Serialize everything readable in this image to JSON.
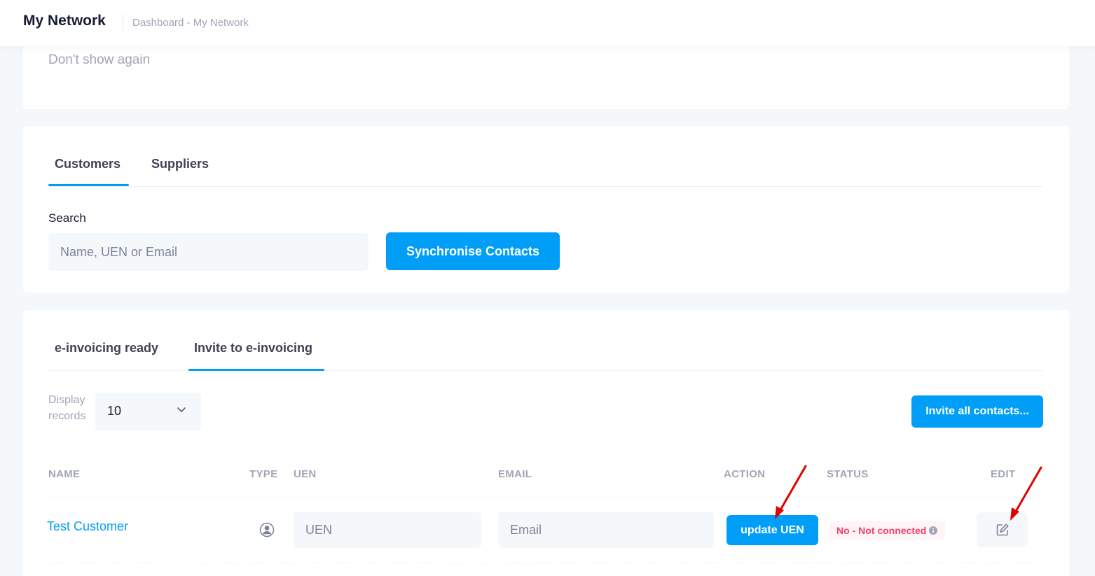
{
  "header": {
    "title": "My Network",
    "breadcrumb": "Dashboard - My Network"
  },
  "notice": {
    "dont_show_again": "Don't show again"
  },
  "contact_tabs": {
    "items": [
      {
        "label": "Customers",
        "active": true
      },
      {
        "label": "Suppliers",
        "active": false
      }
    ]
  },
  "search": {
    "label": "Search",
    "placeholder": "Name, UEN or Email",
    "sync_button": "Synchronise Contacts"
  },
  "invoice_tabs": {
    "items": [
      {
        "label": "e-invoicing ready",
        "active": false
      },
      {
        "label": "Invite to e-invoicing",
        "active": true
      }
    ]
  },
  "table_controls": {
    "display_label": "Display records",
    "display_value": "10",
    "invite_all_button": "Invite all contacts..."
  },
  "table": {
    "columns": [
      "NAME",
      "TYPE",
      "UEN",
      "EMAIL",
      "ACTION",
      "STATUS",
      "EDIT"
    ],
    "rows": [
      {
        "name": "Test Customer",
        "type_icon": "user-circle-icon",
        "uen_placeholder": "UEN",
        "email_placeholder": "Email",
        "action_label": "update UEN",
        "status": "No - Not connected",
        "edit_icon": "edit-icon"
      }
    ]
  },
  "colors": {
    "primary": "#009ef7",
    "danger": "#f1416c",
    "danger_light": "#fff5f8",
    "annotation_arrow": "#e00000"
  }
}
